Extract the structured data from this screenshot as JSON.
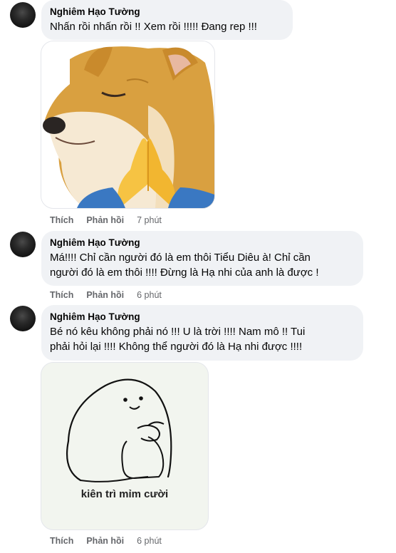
{
  "comments": [
    {
      "author": "Nghiêm Hạo Tường",
      "text": "Nhấn rồi nhấn rồi !! Xem rồi !!!!! Đang rep !!!",
      "sticker": "cheems-praying-dog",
      "actions": {
        "like": "Thích",
        "reply": "Phản hồi",
        "time": "7 phút"
      }
    },
    {
      "author": "Nghiêm Hạo Tường",
      "text_line1": "Má!!!! Chỉ cần người đó là em thôi Tiểu Diêu à! Chỉ cần",
      "text_line2": "người đó là em thôi !!!! Đừng là Hạ nhi của anh là được !",
      "actions": {
        "like": "Thích",
        "reply": "Phản hồi",
        "time": "6 phút"
      }
    },
    {
      "author": "Nghiêm Hạo Tường",
      "text_line1": "Bé nó kêu không phải nó !!! U là trời !!!! Nam mô !! Tui",
      "text_line2": "phải hỏi lại !!!! Không thể người đó là Hạ nhi được !!!!",
      "sticker": "smiling-blob",
      "sticker_caption": "kiên trì mỉm cười",
      "actions": {
        "like": "Thích",
        "reply": "Phản hồi",
        "time": "6 phút"
      }
    }
  ],
  "colors": {
    "bubble": "#f0f2f5",
    "meta_text": "#65676b",
    "text": "#050505"
  }
}
